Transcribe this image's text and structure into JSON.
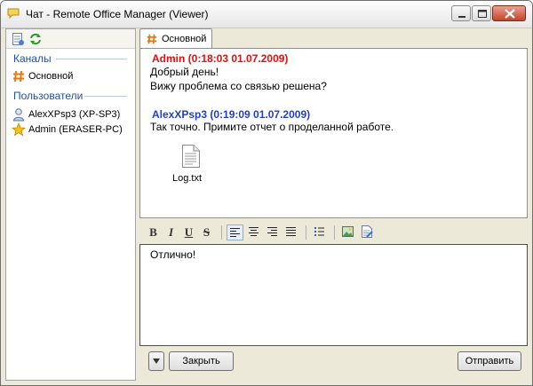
{
  "window": {
    "title": "Чат - Remote Office Manager (Viewer)"
  },
  "sidebar": {
    "channels_heading": "Каналы",
    "channels": [
      {
        "label": "Основной"
      }
    ],
    "users_heading": "Пользователи",
    "users": [
      {
        "label": "AlexXPsp3 (XP-SP3)"
      },
      {
        "label": "Admin (ERASER-PC)"
      }
    ]
  },
  "tabs": [
    {
      "label": "Основной"
    }
  ],
  "messages": [
    {
      "header": "Admin (0:18:03 01.07.2009)",
      "color": "#e01010",
      "lines": [
        "Добрый день!",
        "Вижу проблема со связью решена?"
      ]
    },
    {
      "header": "AlexXPsp3 (0:19:09 01.07.2009)",
      "color": "#1e3fd0",
      "lines": [
        "Так точно. Примите отчет о проделанной работе."
      ],
      "attachment": "Log.txt"
    }
  ],
  "format_toolbar": {
    "bold": "B",
    "italic": "I",
    "underline": "U",
    "strike": "S"
  },
  "input": {
    "value": "Отлично!"
  },
  "buttons": {
    "close": "Закрыть",
    "send": "Отправить"
  },
  "icons": [
    "chat-icon",
    "new-chat-icon",
    "refresh-icon",
    "channel-hash-icon",
    "user-icon",
    "admin-star-icon",
    "text-file-icon",
    "align-left-icon",
    "align-center-icon",
    "align-right-icon",
    "align-justify-icon",
    "bullet-list-icon",
    "insert-image-icon",
    "insert-file-icon",
    "dropdown-arrow-icon"
  ]
}
